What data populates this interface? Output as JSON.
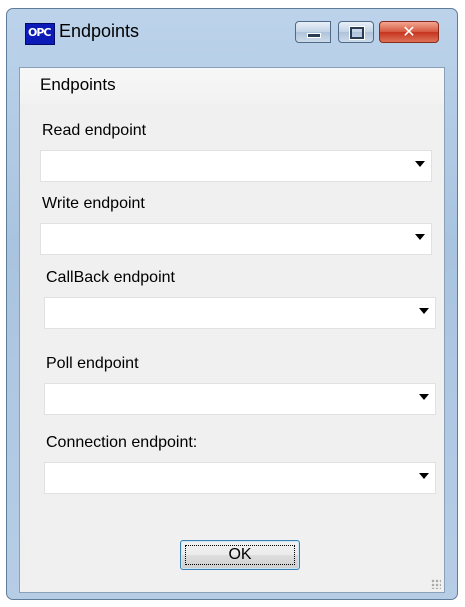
{
  "window": {
    "title": "Endpoints",
    "icon_text": "OPC"
  },
  "section": {
    "title": "Endpoints"
  },
  "fields": {
    "read": {
      "label": "Read endpoint",
      "value": ""
    },
    "write": {
      "label": "Write endpoint",
      "value": ""
    },
    "callback": {
      "label": "CallBack endpoint",
      "value": ""
    },
    "poll": {
      "label": "Poll endpoint",
      "value": ""
    },
    "connection": {
      "label": "Connection endpoint:",
      "value": ""
    }
  },
  "buttons": {
    "ok_label": "OK"
  }
}
